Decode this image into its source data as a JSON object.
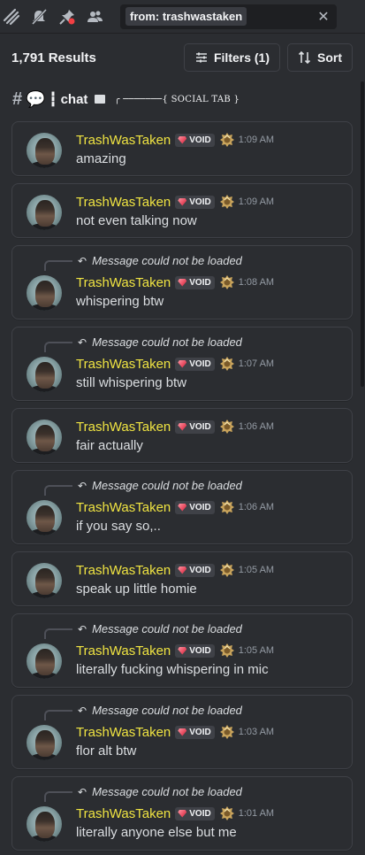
{
  "toolbar": {
    "icons": [
      "threads-icon",
      "mute-bell-icon",
      "pin-icon",
      "members-icon"
    ],
    "search_query": "from: trashwastaken",
    "clear_symbol": "✕"
  },
  "results": {
    "count": "1,791 Results",
    "filters_label": "Filters (1)",
    "sort_label": "Sort"
  },
  "channel": {
    "hash": "#",
    "emoji": "💬",
    "separator": "┇",
    "name": "chat",
    "tag": "╭ ───────{ SOCIAL TAB }"
  },
  "reply_placeholder": "Message could not be loaded",
  "user": {
    "name": "TrashWasTaken",
    "tag": "VOID",
    "name_color": "#f0e442"
  },
  "messages": [
    {
      "time": "1:09 AM",
      "text": "amazing",
      "is_reply": false
    },
    {
      "time": "1:09 AM",
      "text": "not even talking now",
      "is_reply": false
    },
    {
      "time": "1:08 AM",
      "text": "whispering btw",
      "is_reply": true
    },
    {
      "time": "1:07 AM",
      "text": "still whispering btw",
      "is_reply": true
    },
    {
      "time": "1:06 AM",
      "text": "fair actually",
      "is_reply": false
    },
    {
      "time": "1:06 AM",
      "text": "if you say so,..",
      "is_reply": true
    },
    {
      "time": "1:05 AM",
      "text": "speak up little homie",
      "is_reply": false
    },
    {
      "time": "1:05 AM",
      "text": "literally fucking whispering in mic",
      "is_reply": true
    },
    {
      "time": "1:03 AM",
      "text": "flor alt btw",
      "is_reply": true
    },
    {
      "time": "1:01 AM",
      "text": "literally anyone else but me",
      "is_reply": true
    }
  ]
}
